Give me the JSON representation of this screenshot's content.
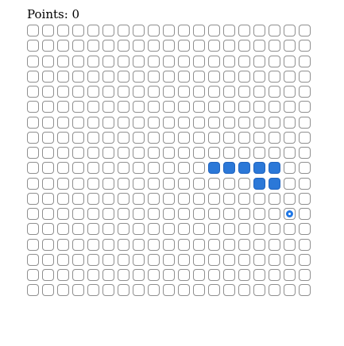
{
  "status": {
    "points_label": "Points: 0"
  },
  "board": {
    "cols": 19,
    "rows": 18,
    "snake": [
      [
        12,
        9
      ],
      [
        13,
        9
      ],
      [
        14,
        9
      ],
      [
        15,
        9
      ],
      [
        15,
        10
      ],
      [
        16,
        10
      ],
      [
        16,
        9
      ]
    ],
    "food": [
      17,
      12
    ]
  },
  "colors": {
    "snake": "#2b78d8",
    "food": "#1f77e6",
    "cell_border": "#8f8f8f"
  }
}
